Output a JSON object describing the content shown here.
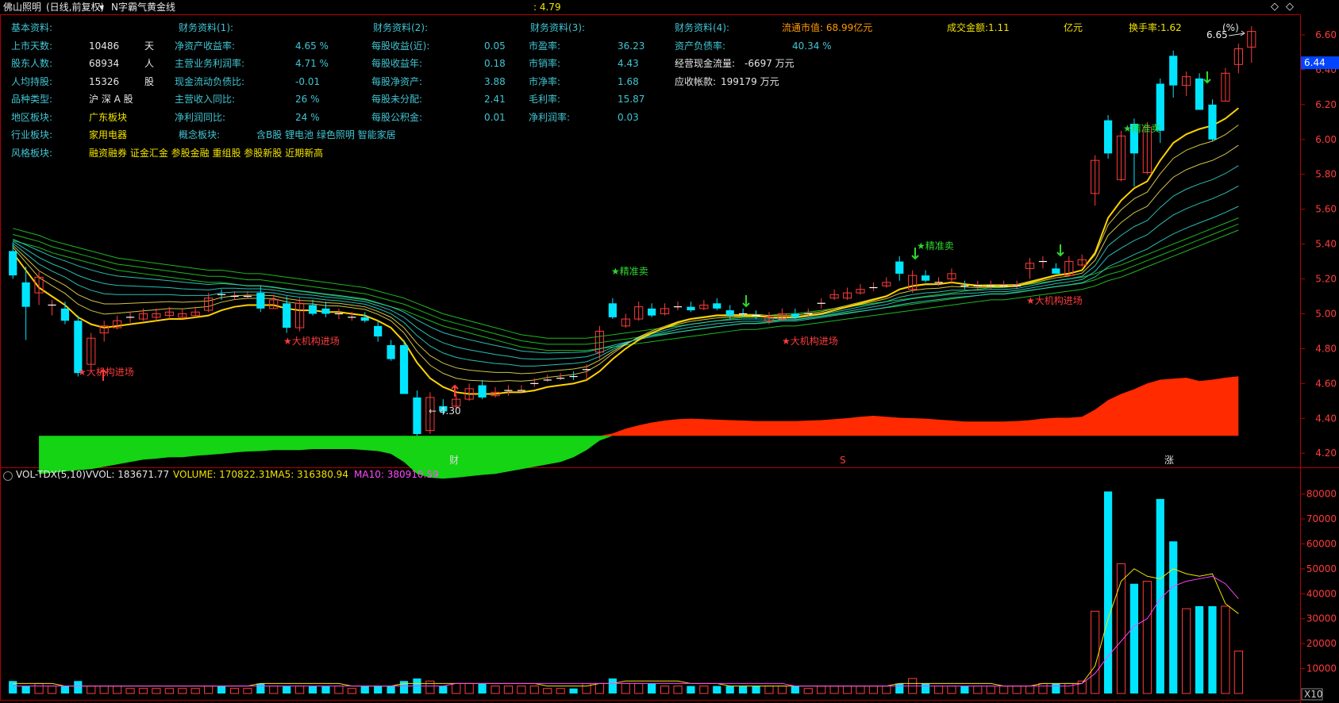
{
  "header": {
    "stock": "佛山照明",
    "mode": "(日线,前复权)",
    "indicator": "N字霸气黄金线",
    "price_label": ": 4.79",
    "pct_label": "(%)"
  },
  "info": {
    "basic": {
      "title": "基本资料:",
      "rows": [
        {
          "k": "上市天数:",
          "v": "10486",
          "u": "天"
        },
        {
          "k": "股东人数:",
          "v": "68934",
          "u": "人"
        },
        {
          "k": "人均持股:",
          "v": "15326",
          "u": "股"
        },
        {
          "k": "品种类型:",
          "v": "沪 深 A 股",
          "u": ""
        },
        {
          "k": "地区板块:",
          "v": "广东板块",
          "u": ""
        },
        {
          "k": "行业板块:",
          "v": "家用电器",
          "u": ""
        },
        {
          "k": "风格板块:",
          "v": "融资融券 证金汇金 参股金融 重组股 参股新股 近期新高",
          "u": ""
        }
      ]
    },
    "concept": {
      "k": "概念板块:",
      "v": "含B股 锂电池 绿色照明 智能家居"
    },
    "fin1": {
      "title": "财务资料(1):",
      "rows": [
        {
          "k": "净资产收益率:",
          "v": "4.65 %"
        },
        {
          "k": "主营业务利润率:",
          "v": "4.71 %"
        },
        {
          "k": "现金流动负债比:",
          "v": "-0.01"
        },
        {
          "k": "主营收入同比:",
          "v": "26 %"
        },
        {
          "k": "净利润同比:",
          "v": "24 %"
        }
      ]
    },
    "fin2": {
      "title": "财务资料(2):",
      "rows": [
        {
          "k": "每股收益(近):",
          "v": "0.05"
        },
        {
          "k": "每股收益年:",
          "v": "0.18"
        },
        {
          "k": "每股净资产:",
          "v": "3.88"
        },
        {
          "k": "每股未分配:",
          "v": "2.41"
        },
        {
          "k": "每股公积金:",
          "v": "0.01"
        }
      ]
    },
    "fin3": {
      "title": "财务资料(3):",
      "rows": [
        {
          "k": "市盈率:",
          "v": "36.23"
        },
        {
          "k": "市销率:",
          "v": "4.43"
        },
        {
          "k": "市净率:",
          "v": "1.68"
        },
        {
          "k": "毛利率:",
          "v": "15.87"
        },
        {
          "k": "净利润率:",
          "v": "0.03"
        }
      ]
    },
    "fin4": {
      "title": "财务资料(4):",
      "rows": [
        {
          "k": "资产负债率:",
          "v": "40.34 %"
        },
        {
          "k": "经营现金流量:",
          "v": "-6697 万元"
        },
        {
          "k": "应收帐款:",
          "v": "199179 万元"
        }
      ]
    },
    "market": {
      "cap": "流通市值: 68.99亿元",
      "amount": "成交金额:1.11",
      "unit": "亿元",
      "turnover": "换手率:1.62"
    }
  },
  "annotations": {
    "peak": "6.65",
    "low": "4.30",
    "institution": "★大机构进场",
    "precise_sell": "★精准卖",
    "date_marks": [
      "财",
      "S",
      "涨"
    ]
  },
  "price_axis": {
    "ticks": [
      "6.60",
      "6.40",
      "6.20",
      "6.00",
      "5.80",
      "5.60",
      "5.40",
      "5.20",
      "5.00",
      "4.80",
      "4.60",
      "4.40",
      "4.20"
    ],
    "current": "6.44"
  },
  "vol": {
    "title": "VOL-TDX(5,10)",
    "vvol": "VVOL: 183671.77",
    "volume": "VOLUME: 170822.31",
    "ma5": "MA5: 316380.94",
    "ma10": "MA10: 380910.59",
    "ticks": [
      "80000",
      "70000",
      "60000",
      "50000",
      "40000",
      "30000",
      "20000",
      "10000"
    ],
    "unit": "X10"
  },
  "colors": {
    "up": "#ff3c3c",
    "down": "#00e5ff",
    "ma5": "#f2e300",
    "ma10": "#ff40ff",
    "gold": "#ffd200",
    "ribbon_inner": "#2fd1c6",
    "ribbon_outer": "#1fb81f",
    "fill_pos": "#ff2a00",
    "fill_neg": "#14d414",
    "axis": "#b30000"
  },
  "chart_data": {
    "type": "candlestick",
    "title": "N字霸气黄金线",
    "ylim": [
      4.16,
      6.7
    ],
    "candles": [
      [
        5.36,
        5.38,
        5.22,
        5.2
      ],
      [
        5.18,
        5.24,
        5.04,
        4.85
      ],
      [
        5.12,
        5.14,
        5.21,
        5.05
      ],
      [
        5.04,
        5.03,
        5.05,
        4.99
      ],
      [
        5.03,
        5.04,
        4.96,
        4.94
      ],
      [
        4.96,
        4.96,
        4.66,
        4.64
      ],
      [
        4.71,
        4.7,
        4.86,
        4.69
      ],
      [
        4.89,
        4.89,
        4.93,
        4.84
      ],
      [
        4.92,
        4.93,
        4.96,
        4.91
      ],
      [
        4.98,
        4.97,
        4.98,
        4.95
      ],
      [
        4.97,
        4.97,
        5.0,
        4.96
      ],
      [
        4.98,
        4.97,
        5.0,
        4.96
      ],
      [
        4.99,
        4.98,
        5.01,
        4.97
      ],
      [
        4.98,
        4.98,
        5.0,
        4.97
      ],
      [
        4.99,
        4.98,
        5.01,
        4.98
      ],
      [
        5.02,
        5.02,
        5.09,
        5.01
      ],
      [
        5.11,
        5.1,
        5.1,
        5.08
      ],
      [
        5.1,
        5.1,
        5.1,
        5.08
      ],
      [
        5.1,
        5.1,
        5.1,
        5.09
      ],
      [
        5.12,
        5.13,
        5.03,
        5.01
      ],
      [
        5.03,
        5.03,
        5.08,
        5.03
      ],
      [
        5.06,
        5.07,
        4.92,
        4.89
      ],
      [
        4.92,
        4.91,
        5.06,
        4.9
      ],
      [
        5.05,
        5.05,
        5.0,
        4.99
      ],
      [
        5.03,
        5.04,
        5.0,
        4.98
      ],
      [
        5.0,
        5.0,
        5.0,
        4.97
      ],
      [
        4.98,
        4.98,
        4.98,
        4.96
      ],
      [
        4.98,
        4.98,
        4.96,
        4.95
      ],
      [
        4.93,
        4.93,
        4.87,
        4.84
      ],
      [
        4.82,
        4.82,
        4.74,
        4.73
      ],
      [
        4.82,
        4.82,
        4.54,
        4.54
      ],
      [
        4.52,
        4.53,
        4.31,
        4.3
      ],
      [
        4.33,
        4.33,
        4.52,
        4.31
      ],
      [
        4.47,
        4.48,
        4.44,
        4.42
      ],
      [
        4.47,
        4.47,
        4.51,
        4.44
      ],
      [
        4.51,
        4.51,
        4.57,
        4.5
      ],
      [
        4.59,
        4.58,
        4.52,
        4.51
      ],
      [
        4.53,
        4.53,
        4.55,
        4.52
      ],
      [
        4.55,
        4.55,
        4.56,
        4.53
      ],
      [
        4.56,
        4.55,
        4.56,
        4.55
      ],
      [
        4.6,
        4.59,
        4.6,
        4.58
      ],
      [
        4.62,
        4.62,
        4.62,
        4.61
      ],
      [
        4.63,
        4.62,
        4.63,
        4.62
      ],
      [
        4.64,
        4.63,
        4.63,
        4.62
      ],
      [
        4.68,
        4.67,
        4.68,
        4.62
      ],
      [
        4.78,
        4.77,
        4.9,
        4.74
      ],
      [
        5.06,
        5.06,
        4.98,
        4.97
      ],
      [
        4.93,
        4.93,
        4.97,
        4.92
      ],
      [
        4.97,
        4.97,
        5.04,
        4.96
      ],
      [
        5.03,
        5.02,
        4.99,
        4.98
      ],
      [
        5.0,
        5.0,
        5.03,
        4.99
      ],
      [
        5.03,
        5.03,
        5.04,
        5.02
      ],
      [
        5.04,
        5.04,
        5.02,
        5.01
      ],
      [
        5.03,
        5.03,
        5.05,
        5.02
      ],
      [
        5.06,
        5.06,
        5.03,
        5.02
      ],
      [
        5.02,
        5.02,
        4.99,
        4.97
      ],
      [
        5.0,
        5.0,
        4.99,
        4.98
      ],
      [
        4.99,
        4.98,
        4.98,
        4.97
      ],
      [
        4.96,
        4.96,
        4.98,
        4.94
      ],
      [
        4.97,
        4.97,
        5.0,
        4.96
      ],
      [
        5.0,
        4.99,
        4.98,
        4.97
      ],
      [
        4.99,
        4.99,
        5.0,
        4.98
      ],
      [
        5.06,
        5.06,
        5.06,
        5.03
      ],
      [
        5.09,
        5.09,
        5.11,
        5.08
      ],
      [
        5.09,
        5.09,
        5.12,
        5.08
      ],
      [
        5.12,
        5.13,
        5.14,
        5.11
      ],
      [
        5.14,
        5.15,
        5.15,
        5.13
      ],
      [
        5.16,
        5.16,
        5.18,
        5.15
      ],
      [
        5.3,
        5.3,
        5.23,
        5.19
      ],
      [
        5.14,
        5.13,
        5.22,
        5.12
      ],
      [
        5.22,
        5.22,
        5.19,
        5.18
      ],
      [
        5.17,
        5.17,
        5.18,
        5.16
      ],
      [
        5.2,
        5.2,
        5.23,
        5.17
      ],
      [
        5.16,
        5.16,
        5.15,
        5.14
      ],
      [
        5.15,
        5.15,
        5.16,
        5.14
      ],
      [
        5.16,
        5.16,
        5.16,
        5.14
      ],
      [
        5.16,
        5.16,
        5.16,
        5.15
      ],
      [
        5.15,
        5.15,
        5.16,
        5.14
      ],
      [
        5.26,
        5.26,
        5.29,
        5.2
      ],
      [
        5.29,
        5.28,
        5.3,
        5.26
      ],
      [
        5.26,
        5.26,
        5.23,
        5.23
      ],
      [
        5.22,
        5.22,
        5.3,
        5.22
      ],
      [
        5.28,
        5.27,
        5.31,
        5.27
      ],
      [
        5.69,
        5.69,
        5.88,
        5.62
      ],
      [
        6.11,
        6.1,
        5.92,
        5.89
      ],
      [
        5.77,
        5.76,
        6.02,
        5.76
      ],
      [
        6.09,
        6.08,
        5.92,
        5.73
      ],
      [
        5.81,
        5.81,
        6.07,
        5.8
      ],
      [
        6.32,
        6.31,
        6.05,
        5.98
      ],
      [
        6.48,
        6.47,
        6.31,
        6.24
      ],
      [
        6.31,
        6.3,
        6.36,
        6.25
      ],
      [
        6.35,
        6.35,
        6.17,
        6.19
      ],
      [
        6.2,
        6.2,
        6.0,
        5.99
      ],
      [
        6.22,
        6.21,
        6.38,
        6.22
      ],
      [
        6.43,
        6.43,
        6.52,
        6.38
      ],
      [
        6.53,
        6.52,
        6.62,
        6.44
      ]
    ],
    "volume": [
      5,
      3,
      4,
      3,
      3,
      5,
      3,
      3,
      3,
      2,
      2,
      2,
      2,
      2,
      2,
      3,
      3,
      2,
      2,
      4,
      3,
      3,
      3,
      3,
      3,
      3,
      2,
      3,
      3,
      3,
      5,
      6,
      5,
      3,
      4,
      4,
      4,
      3,
      3,
      3,
      3,
      2,
      2,
      2,
      4,
      4,
      6,
      4,
      4,
      4,
      3,
      3,
      3,
      3,
      3,
      3,
      3,
      3,
      3,
      3,
      3,
      2,
      3,
      3,
      3,
      3,
      3,
      3,
      4,
      6,
      4,
      3,
      3,
      3,
      3,
      3,
      3,
      3,
      3,
      4,
      4,
      4,
      5,
      33,
      81,
      52,
      44,
      45,
      78,
      61,
      34,
      35,
      35,
      35,
      17
    ],
    "ma5": [
      4,
      4,
      4,
      4,
      3,
      3,
      3,
      3,
      3,
      3,
      3,
      3,
      3,
      3,
      3,
      3,
      3,
      3,
      3,
      4,
      4,
      4,
      4,
      4,
      4,
      4,
      3,
      3,
      3,
      3,
      4,
      4,
      4,
      4,
      4,
      4,
      4,
      4,
      4,
      4,
      4,
      3,
      3,
      3,
      3,
      4,
      4,
      5,
      5,
      5,
      5,
      5,
      4,
      4,
      4,
      3,
      3,
      3,
      3,
      3,
      3,
      3,
      3,
      3,
      3,
      3,
      3,
      3,
      4,
      4,
      4,
      4,
      4,
      4,
      4,
      4,
      3,
      3,
      3,
      4,
      4,
      4,
      4,
      11,
      30,
      45,
      50,
      47,
      46,
      50,
      48,
      47,
      48,
      36,
      32
    ],
    "ma10": [
      3,
      3,
      3,
      3,
      3,
      3,
      3,
      3,
      3,
      3,
      3,
      3,
      3,
      3,
      3,
      3,
      3,
      3,
      3,
      3,
      3,
      3,
      3,
      3,
      3,
      3,
      3,
      3,
      3,
      3,
      3,
      3,
      3,
      3,
      4,
      4,
      4,
      4,
      4,
      4,
      4,
      4,
      4,
      4,
      4,
      4,
      4,
      4,
      4,
      4,
      4,
      4,
      4,
      4,
      4,
      4,
      4,
      4,
      4,
      4,
      3,
      3,
      3,
      3,
      3,
      3,
      3,
      3,
      3,
      3,
      3,
      3,
      3,
      3,
      3,
      3,
      3,
      3,
      3,
      3,
      3,
      3,
      4,
      8,
      15,
      21,
      27,
      30,
      38,
      43,
      45,
      46,
      47,
      44,
      38
    ],
    "ma_ribbon_lo": [
      5.42,
      5.4,
      5.38,
      5.35,
      5.33,
      5.31,
      5.29,
      5.27,
      5.25,
      5.24,
      5.23,
      5.22,
      5.21,
      5.2,
      5.19,
      5.18,
      5.18,
      5.17,
      5.16,
      5.16,
      5.15,
      5.14,
      5.13,
      5.12,
      5.11,
      5.1,
      5.09,
      5.08,
      5.06,
      5.04,
      5.02,
      4.99,
      4.96,
      4.93,
      4.91,
      4.89,
      4.87,
      4.85,
      4.83,
      4.81,
      4.8,
      4.79,
      4.79,
      4.79,
      4.79,
      4.8,
      4.81,
      4.82,
      4.83,
      4.84,
      4.85,
      4.86,
      4.87,
      4.88,
      4.89,
      4.9,
      4.91,
      4.91,
      4.92,
      4.93,
      4.93,
      4.94,
      4.95,
      4.96,
      4.97,
      4.98,
      4.99,
      5.0,
      5.01,
      5.02,
      5.03,
      5.04,
      5.05,
      5.06,
      5.07,
      5.08,
      5.08,
      5.09,
      5.1,
      5.11,
      5.12,
      5.13,
      5.14,
      5.16,
      5.19,
      5.21,
      5.24,
      5.27,
      5.3,
      5.33,
      5.36,
      5.39,
      5.42,
      5.45,
      5.48
    ],
    "gold_line": [
      5.35,
      5.25,
      5.15,
      5.1,
      5.05,
      4.98,
      4.94,
      4.92,
      4.93,
      4.94,
      4.95,
      4.96,
      4.97,
      4.97,
      4.98,
      4.99,
      5.02,
      5.04,
      5.05,
      5.05,
      5.05,
      5.03,
      5.02,
      5.02,
      5.01,
      5.01,
      5.0,
      4.99,
      4.96,
      4.92,
      4.84,
      4.72,
      4.63,
      4.58,
      4.55,
      4.54,
      4.54,
      4.54,
      4.55,
      4.55,
      4.56,
      4.58,
      4.59,
      4.6,
      4.62,
      4.67,
      4.74,
      4.8,
      4.85,
      4.89,
      4.92,
      4.95,
      4.97,
      4.98,
      4.99,
      4.99,
      4.99,
      4.99,
      4.98,
      4.98,
      4.98,
      4.99,
      5.0,
      5.02,
      5.04,
      5.06,
      5.08,
      5.1,
      5.14,
      5.16,
      5.17,
      5.17,
      5.18,
      5.17,
      5.16,
      5.16,
      5.16,
      5.16,
      5.18,
      5.2,
      5.22,
      5.23,
      5.25,
      5.35,
      5.55,
      5.65,
      5.72,
      5.76,
      5.88,
      5.98,
      6.03,
      6.06,
      6.08,
      6.12,
      6.18
    ],
    "fill_values": [
      -0.45,
      -0.75,
      -0.8,
      -0.78,
      -0.75,
      -0.72,
      -0.7,
      -0.65,
      -0.6,
      -0.55,
      -0.5,
      -0.48,
      -0.45,
      -0.45,
      -0.42,
      -0.4,
      -0.38,
      -0.35,
      -0.33,
      -0.32,
      -0.3,
      -0.3,
      -0.3,
      -0.28,
      -0.28,
      -0.28,
      -0.28,
      -0.3,
      -0.32,
      -0.38,
      -0.55,
      -0.8,
      -0.88,
      -0.9,
      -0.88,
      -0.85,
      -0.82,
      -0.8,
      -0.75,
      -0.7,
      -0.65,
      -0.6,
      -0.55,
      -0.45,
      -0.3,
      -0.1,
      0.05,
      0.15,
      0.22,
      0.28,
      0.32,
      0.35,
      0.36,
      0.35,
      0.34,
      0.33,
      0.32,
      0.31,
      0.31,
      0.31,
      0.31,
      0.32,
      0.33,
      0.35,
      0.37,
      0.4,
      0.42,
      0.4,
      0.38,
      0.37,
      0.36,
      0.34,
      0.32,
      0.3,
      0.3,
      0.3,
      0.3,
      0.31,
      0.33,
      0.36,
      0.38,
      0.38,
      0.4,
      0.55,
      0.75,
      0.88,
      0.98,
      1.1,
      1.18,
      1.2,
      1.22,
      1.15,
      1.18,
      1.22,
      1.25
    ]
  }
}
